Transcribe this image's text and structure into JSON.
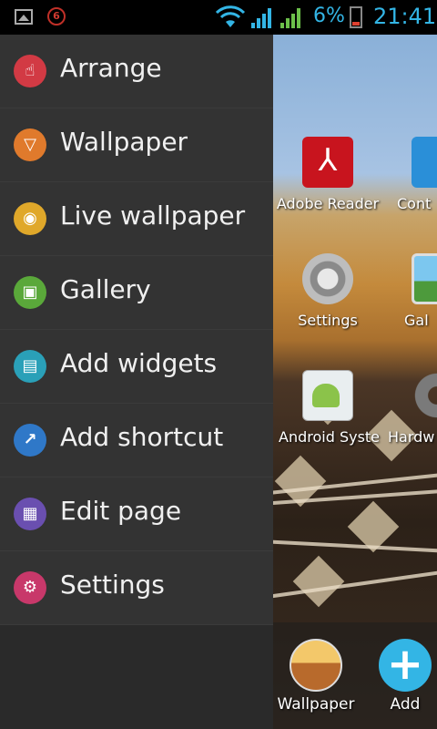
{
  "status_bar": {
    "notification_count": "6",
    "battery_percent": "6%",
    "time": "21:41"
  },
  "menu": {
    "items": [
      {
        "label": "Arrange",
        "icon": "hand-touch-icon",
        "color": "#d23a44",
        "glyph": "☝"
      },
      {
        "label": "Wallpaper",
        "icon": "wallpaper-icon",
        "color": "#e07a2c",
        "glyph": "▽"
      },
      {
        "label": "Live wallpaper",
        "icon": "live-wallpaper-icon",
        "color": "#e0a82a",
        "glyph": "◉"
      },
      {
        "label": "Gallery",
        "icon": "gallery-icon",
        "color": "#5aa83a",
        "glyph": "▣"
      },
      {
        "label": "Add widgets",
        "icon": "widgets-icon",
        "color": "#2aa0b8",
        "glyph": "▤"
      },
      {
        "label": "Add shortcut",
        "icon": "shortcut-icon",
        "color": "#2f78c8",
        "glyph": "↗"
      },
      {
        "label": "Edit page",
        "icon": "edit-page-icon",
        "color": "#6a4fb0",
        "glyph": "▦"
      },
      {
        "label": "Settings",
        "icon": "settings-icon",
        "color": "#c8386a",
        "glyph": "⚙"
      }
    ]
  },
  "home": {
    "apps": [
      {
        "label": "Adobe Reader",
        "icon": "adobe-reader-icon"
      },
      {
        "label": "Cont",
        "icon": "contacts-icon"
      },
      {
        "label": "Settings",
        "icon": "settings-app-icon"
      },
      {
        "label": "Gal",
        "icon": "gallery-app-icon"
      },
      {
        "label": "Android Syste",
        "icon": "android-system-icon"
      },
      {
        "label": "Hardw",
        "icon": "hardware-icon"
      }
    ],
    "dock": [
      {
        "label": "Wallpaper",
        "icon": "wallpaper-dock-icon"
      },
      {
        "label": "Add",
        "icon": "add-dock-icon"
      }
    ]
  }
}
